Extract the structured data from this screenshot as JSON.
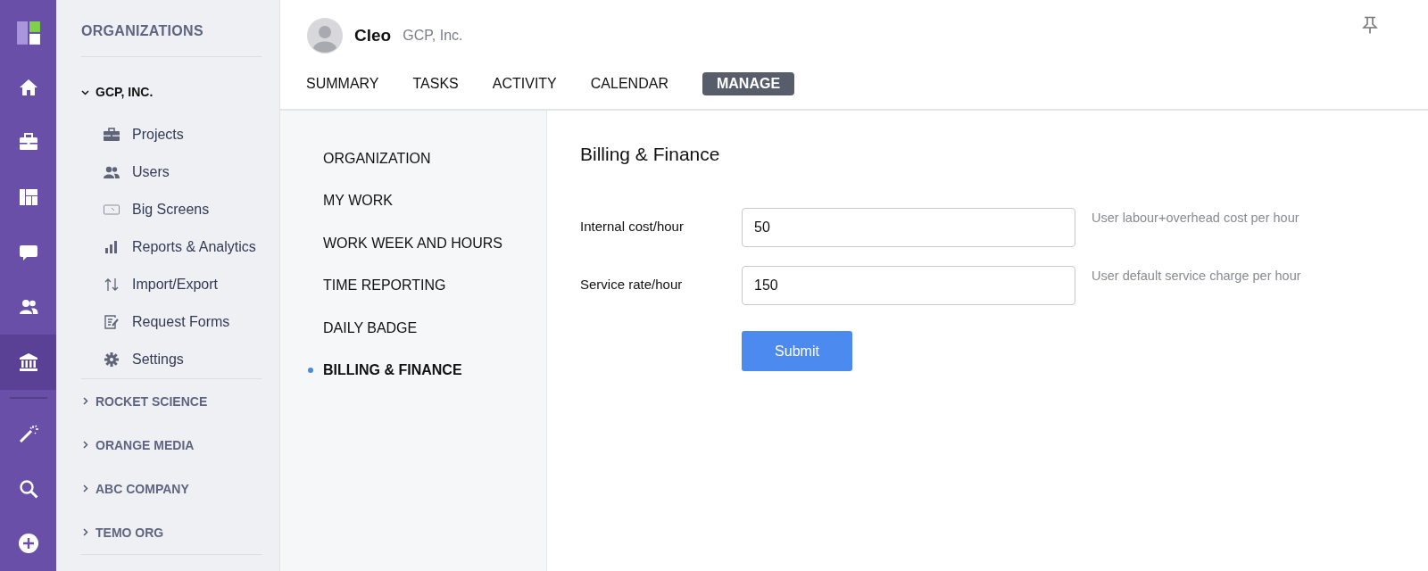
{
  "rail": {
    "items": [
      {
        "selected": false
      },
      {
        "selected": false
      },
      {
        "selected": false
      },
      {
        "selected": false
      },
      {
        "selected": false
      },
      {
        "selected": true
      },
      {
        "selected": false
      },
      {
        "selected": false
      },
      {
        "selected": false
      }
    ]
  },
  "sidebar": {
    "heading": "ORGANIZATIONS",
    "organizations": [
      {
        "name": "GCP, INC.",
        "expanded": true,
        "children": [
          {
            "label": "Projects"
          },
          {
            "label": "Users"
          },
          {
            "label": "Big Screens"
          },
          {
            "label": "Reports & Analytics"
          },
          {
            "label": "Import/Export"
          },
          {
            "label": "Request Forms"
          },
          {
            "label": "Settings"
          }
        ]
      },
      {
        "name": "ROCKET SCIENCE",
        "expanded": false
      },
      {
        "name": "ORANGE MEDIA",
        "expanded": false
      },
      {
        "name": "ABC COMPANY",
        "expanded": false
      },
      {
        "name": "TEMO ORG",
        "expanded": false
      }
    ]
  },
  "header": {
    "user_name": "Cleo",
    "organization": "GCP, Inc."
  },
  "tabs": [
    {
      "label": "SUMMARY",
      "selected": false
    },
    {
      "label": "TASKS",
      "selected": false
    },
    {
      "label": "ACTIVITY",
      "selected": false
    },
    {
      "label": "CALENDAR",
      "selected": false
    },
    {
      "label": "MANAGE",
      "selected": true
    }
  ],
  "manage_menu": [
    {
      "label": "ORGANIZATION",
      "selected": false
    },
    {
      "label": "MY WORK",
      "selected": false
    },
    {
      "label": "WORK WEEK AND HOURS",
      "selected": false
    },
    {
      "label": "TIME REPORTING",
      "selected": false
    },
    {
      "label": "DAILY BADGE",
      "selected": false
    },
    {
      "label": "BILLING & FINANCE",
      "selected": true
    }
  ],
  "form": {
    "title": "Billing & Finance",
    "fields": [
      {
        "label": "Internal cost/hour",
        "value": "50",
        "hint": "User labour+overhead cost per hour"
      },
      {
        "label": "Service rate/hour",
        "value": "150",
        "hint": "User default service charge per hour"
      }
    ],
    "submit": "Submit"
  }
}
